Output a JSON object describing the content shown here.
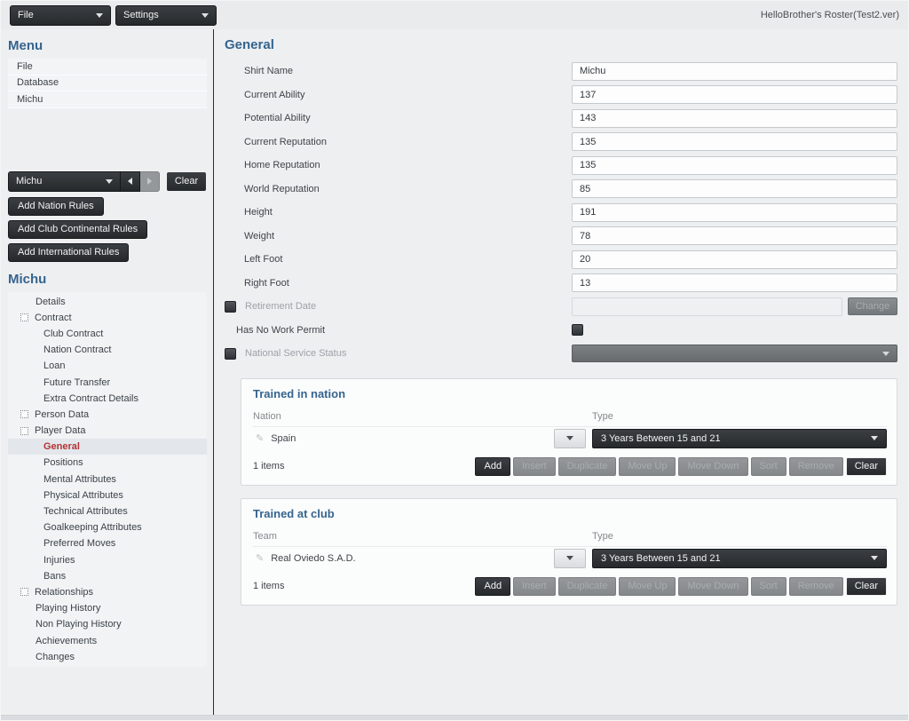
{
  "window_title": "HelloBrother's Roster(Test2.ver)",
  "menubar": {
    "file_label": "File",
    "settings_label": "Settings"
  },
  "sidebar": {
    "menu_heading": "Menu",
    "menu_items": [
      {
        "label": "File"
      },
      {
        "label": "Database"
      },
      {
        "label": "Michu"
      }
    ],
    "record_nav": {
      "selected": "Michu",
      "clear_label": "Clear"
    },
    "rule_buttons": [
      {
        "label": "Add Nation Rules"
      },
      {
        "label": "Add Club Continental Rules"
      },
      {
        "label": "Add International Rules"
      }
    ],
    "tree_heading": "Michu",
    "tree_items": [
      {
        "label": "Details",
        "level": 1,
        "expander": false,
        "selected": false
      },
      {
        "label": "Contract",
        "level": 1,
        "expander": true,
        "selected": false
      },
      {
        "label": "Club Contract",
        "level": 2,
        "expander": false,
        "selected": false
      },
      {
        "label": "Nation Contract",
        "level": 2,
        "expander": false,
        "selected": false
      },
      {
        "label": "Loan",
        "level": 2,
        "expander": false,
        "selected": false
      },
      {
        "label": "Future Transfer",
        "level": 2,
        "expander": false,
        "selected": false
      },
      {
        "label": "Extra Contract Details",
        "level": 2,
        "expander": false,
        "selected": false
      },
      {
        "label": "Person Data",
        "level": 1,
        "expander": true,
        "selected": false
      },
      {
        "label": "Player Data",
        "level": 1,
        "expander": true,
        "selected": false
      },
      {
        "label": "General",
        "level": 2,
        "expander": false,
        "selected": true
      },
      {
        "label": "Positions",
        "level": 2,
        "expander": false,
        "selected": false
      },
      {
        "label": "Mental Attributes",
        "level": 2,
        "expander": false,
        "selected": false
      },
      {
        "label": "Physical Attributes",
        "level": 2,
        "expander": false,
        "selected": false
      },
      {
        "label": "Technical Attributes",
        "level": 2,
        "expander": false,
        "selected": false
      },
      {
        "label": "Goalkeeping Attributes",
        "level": 2,
        "expander": false,
        "selected": false
      },
      {
        "label": "Preferred Moves",
        "level": 2,
        "expander": false,
        "selected": false
      },
      {
        "label": "Injuries",
        "level": 2,
        "expander": false,
        "selected": false
      },
      {
        "label": "Bans",
        "level": 2,
        "expander": false,
        "selected": false
      },
      {
        "label": "Relationships",
        "level": 1,
        "expander": true,
        "selected": false
      },
      {
        "label": "Playing History",
        "level": 1,
        "expander": false,
        "selected": false
      },
      {
        "label": "Non Playing History",
        "level": 1,
        "expander": false,
        "selected": false
      },
      {
        "label": "Achievements",
        "level": 1,
        "expander": false,
        "selected": false
      },
      {
        "label": "Changes",
        "level": 1,
        "expander": false,
        "selected": false
      }
    ]
  },
  "main": {
    "heading": "General",
    "fields": [
      {
        "label": "Shirt Name",
        "value": "Michu"
      },
      {
        "label": "Current Ability",
        "value": "137"
      },
      {
        "label": "Potential Ability",
        "value": "143"
      },
      {
        "label": "Current Reputation",
        "value": "135"
      },
      {
        "label": "Home Reputation",
        "value": "135"
      },
      {
        "label": "World Reputation",
        "value": "85"
      },
      {
        "label": "Height",
        "value": "191"
      },
      {
        "label": "Weight",
        "value": "78"
      },
      {
        "label": "Left Foot",
        "value": "20"
      },
      {
        "label": "Right Foot",
        "value": "13"
      }
    ],
    "retirement": {
      "label": "Retirement Date",
      "value": "",
      "change_label": "Change"
    },
    "work_permit": {
      "label": "Has No Work Permit"
    },
    "national_service": {
      "label": "National Service Status",
      "value": ""
    },
    "panels": [
      {
        "title": "Trained in nation",
        "column_label": "Nation",
        "type_label": "Type",
        "item": "Spain",
        "type_value": "3 Years Between 15 and 21",
        "count": "1 items"
      },
      {
        "title": "Trained at club",
        "column_label": "Team",
        "type_label": "Type",
        "item": "Real Oviedo S.A.D.",
        "type_value": "3 Years Between 15 and 21",
        "count": "1 items"
      }
    ],
    "panel_buttons": [
      {
        "label": "Add",
        "enabled": true,
        "outlined": false
      },
      {
        "label": "Insert",
        "enabled": false,
        "outlined": false
      },
      {
        "label": "Duplicate",
        "enabled": false,
        "outlined": false
      },
      {
        "label": "Move Up",
        "enabled": false,
        "outlined": false
      },
      {
        "label": "Move Down",
        "enabled": false,
        "outlined": false
      },
      {
        "label": "Sort",
        "enabled": false,
        "outlined": false
      },
      {
        "label": "Remove",
        "enabled": false,
        "outlined": false
      },
      {
        "label": "Clear",
        "enabled": true,
        "outlined": true
      }
    ]
  },
  "colors": {
    "accent_blue": "#35648e",
    "selected_red": "#b23335",
    "dark_control": "#2b2f33",
    "disabled_gray": "#8b8f92",
    "background": "#edeff1"
  }
}
